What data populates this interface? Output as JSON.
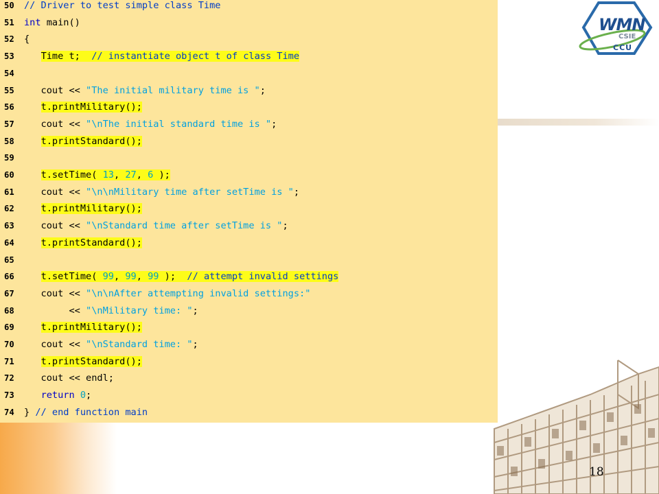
{
  "logo": {
    "title": "WMN",
    "subtitle": "CSIE",
    "org": "CCU"
  },
  "page_number": "18",
  "colors": {
    "panel_bg": "#fde59c",
    "highlight": "#fdfc19",
    "comment": "#003cc7",
    "string": "#00a0e0",
    "keyword": "#0000c8",
    "number": "#00a0c0",
    "accent_orange": "#f7a94a"
  },
  "code_lines": [
    {
      "num": "50",
      "segments": [
        {
          "t": "// Driver to test simple class Time",
          "c": "comment"
        }
      ]
    },
    {
      "num": "51",
      "segments": [
        {
          "t": "int",
          "c": "keyword"
        },
        {
          "t": " main()",
          "c": "plain"
        }
      ]
    },
    {
      "num": "52",
      "segments": [
        {
          "t": "{",
          "c": "plain"
        }
      ]
    },
    {
      "num": "53",
      "segments": [
        {
          "t": "   ",
          "c": "plain"
        },
        {
          "t": "Time t;  ",
          "c": "plain",
          "hl": true
        },
        {
          "t": "// instantiate object t of class Time",
          "c": "comment",
          "hl": true
        }
      ]
    },
    {
      "num": "54",
      "segments": []
    },
    {
      "num": "55",
      "segments": [
        {
          "t": "   cout << ",
          "c": "plain"
        },
        {
          "t": "\"The initial military time is \"",
          "c": "string"
        },
        {
          "t": ";",
          "c": "plain"
        }
      ]
    },
    {
      "num": "56",
      "segments": [
        {
          "t": "   ",
          "c": "plain"
        },
        {
          "t": "t.printMilitary();",
          "c": "plain",
          "hl": true
        }
      ]
    },
    {
      "num": "57",
      "segments": [
        {
          "t": "   cout << ",
          "c": "plain"
        },
        {
          "t": "\"\\nThe initial standard time is \"",
          "c": "string"
        },
        {
          "t": ";",
          "c": "plain"
        }
      ]
    },
    {
      "num": "58",
      "segments": [
        {
          "t": "   ",
          "c": "plain"
        },
        {
          "t": "t.printStandard();",
          "c": "plain",
          "hl": true
        }
      ]
    },
    {
      "num": "59",
      "segments": []
    },
    {
      "num": "60",
      "segments": [
        {
          "t": "   ",
          "c": "plain"
        },
        {
          "t": "t.setTime( ",
          "c": "plain",
          "hl": true
        },
        {
          "t": "13",
          "c": "number",
          "hl": true
        },
        {
          "t": ", ",
          "c": "plain",
          "hl": true
        },
        {
          "t": "27",
          "c": "number",
          "hl": true
        },
        {
          "t": ", ",
          "c": "plain",
          "hl": true
        },
        {
          "t": "6",
          "c": "number",
          "hl": true
        },
        {
          "t": " );",
          "c": "plain",
          "hl": true
        }
      ]
    },
    {
      "num": "61",
      "segments": [
        {
          "t": "   cout << ",
          "c": "plain"
        },
        {
          "t": "\"\\n\\nMilitary time after setTime is \"",
          "c": "string"
        },
        {
          "t": ";",
          "c": "plain"
        }
      ]
    },
    {
      "num": "62",
      "segments": [
        {
          "t": "   ",
          "c": "plain"
        },
        {
          "t": "t.printMilitary();",
          "c": "plain",
          "hl": true
        }
      ]
    },
    {
      "num": "63",
      "segments": [
        {
          "t": "   cout << ",
          "c": "plain"
        },
        {
          "t": "\"\\nStandard time after setTime is \"",
          "c": "string"
        },
        {
          "t": ";",
          "c": "plain"
        }
      ]
    },
    {
      "num": "64",
      "segments": [
        {
          "t": "   ",
          "c": "plain"
        },
        {
          "t": "t.printStandard();",
          "c": "plain",
          "hl": true
        }
      ]
    },
    {
      "num": "65",
      "segments": []
    },
    {
      "num": "66",
      "segments": [
        {
          "t": "   ",
          "c": "plain"
        },
        {
          "t": "t.setTime( ",
          "c": "plain",
          "hl": true
        },
        {
          "t": "99",
          "c": "number",
          "hl": true
        },
        {
          "t": ", ",
          "c": "plain",
          "hl": true
        },
        {
          "t": "99",
          "c": "number",
          "hl": true
        },
        {
          "t": ", ",
          "c": "plain",
          "hl": true
        },
        {
          "t": "99",
          "c": "number",
          "hl": true
        },
        {
          "t": " );  ",
          "c": "plain",
          "hl": true
        },
        {
          "t": "// attempt invalid settings",
          "c": "comment",
          "hl": true
        }
      ]
    },
    {
      "num": "67",
      "segments": [
        {
          "t": "   cout << ",
          "c": "plain"
        },
        {
          "t": "\"\\n\\nAfter attempting invalid settings:\"",
          "c": "string"
        }
      ]
    },
    {
      "num": "68",
      "segments": [
        {
          "t": "        << ",
          "c": "plain"
        },
        {
          "t": "\"\\nMilitary time: \"",
          "c": "string"
        },
        {
          "t": ";",
          "c": "plain"
        }
      ]
    },
    {
      "num": "69",
      "segments": [
        {
          "t": "   ",
          "c": "plain"
        },
        {
          "t": "t.printMilitary();",
          "c": "plain",
          "hl": true
        }
      ]
    },
    {
      "num": "70",
      "segments": [
        {
          "t": "   cout << ",
          "c": "plain"
        },
        {
          "t": "\"\\nStandard time: \"",
          "c": "string"
        },
        {
          "t": ";",
          "c": "plain"
        }
      ]
    },
    {
      "num": "71",
      "segments": [
        {
          "t": "   ",
          "c": "plain"
        },
        {
          "t": "t.printStandard();",
          "c": "plain",
          "hl": true
        }
      ]
    },
    {
      "num": "72",
      "segments": [
        {
          "t": "   cout << endl;",
          "c": "plain"
        }
      ]
    },
    {
      "num": "73",
      "segments": [
        {
          "t": "   ",
          "c": "plain"
        },
        {
          "t": "return",
          "c": "keyword"
        },
        {
          "t": " ",
          "c": "plain"
        },
        {
          "t": "0",
          "c": "number"
        },
        {
          "t": ";",
          "c": "plain"
        }
      ]
    },
    {
      "num": "74",
      "segments": [
        {
          "t": "} ",
          "c": "plain"
        },
        {
          "t": "// end function main",
          "c": "comment"
        }
      ]
    }
  ]
}
